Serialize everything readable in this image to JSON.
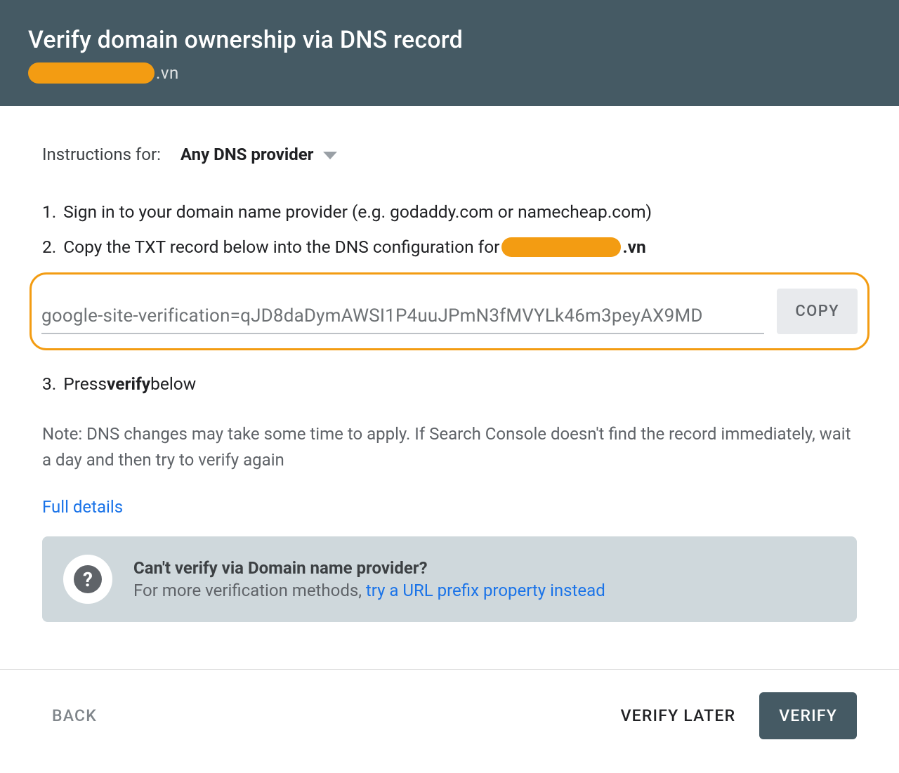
{
  "header": {
    "title": "Verify domain ownership via DNS record",
    "domain_suffix": ".vn"
  },
  "instructions": {
    "for_label": "Instructions for:",
    "provider_selected": "Any DNS provider"
  },
  "steps": {
    "s1_num": "1.",
    "s1_text": "Sign in to your domain name provider (e.g. godaddy.com or namecheap.com)",
    "s2_num": "2.",
    "s2_text_pre": "Copy the TXT record below into the DNS configuration for ",
    "s2_vn": ".vn",
    "txt_record": "google-site-verification=qJD8daDymAWSI1P4uuJPmN3fMVYLk46m3peyAX9MD",
    "copy_label": "COPY",
    "s3_num": "3.",
    "s3_pre": "Press ",
    "s3_bold": "verify",
    "s3_post": " below"
  },
  "note": "Note: DNS changes may take some time to apply. If Search Console doesn't find the record immediately, wait a day and then try to verify again",
  "full_details": "Full details",
  "cant_box": {
    "title": "Can't verify via Domain name provider?",
    "sub_pre": "For more verification methods, ",
    "sub_link": "try a URL prefix property instead"
  },
  "footer": {
    "back": "BACK",
    "later": "VERIFY LATER",
    "verify": "VERIFY"
  }
}
